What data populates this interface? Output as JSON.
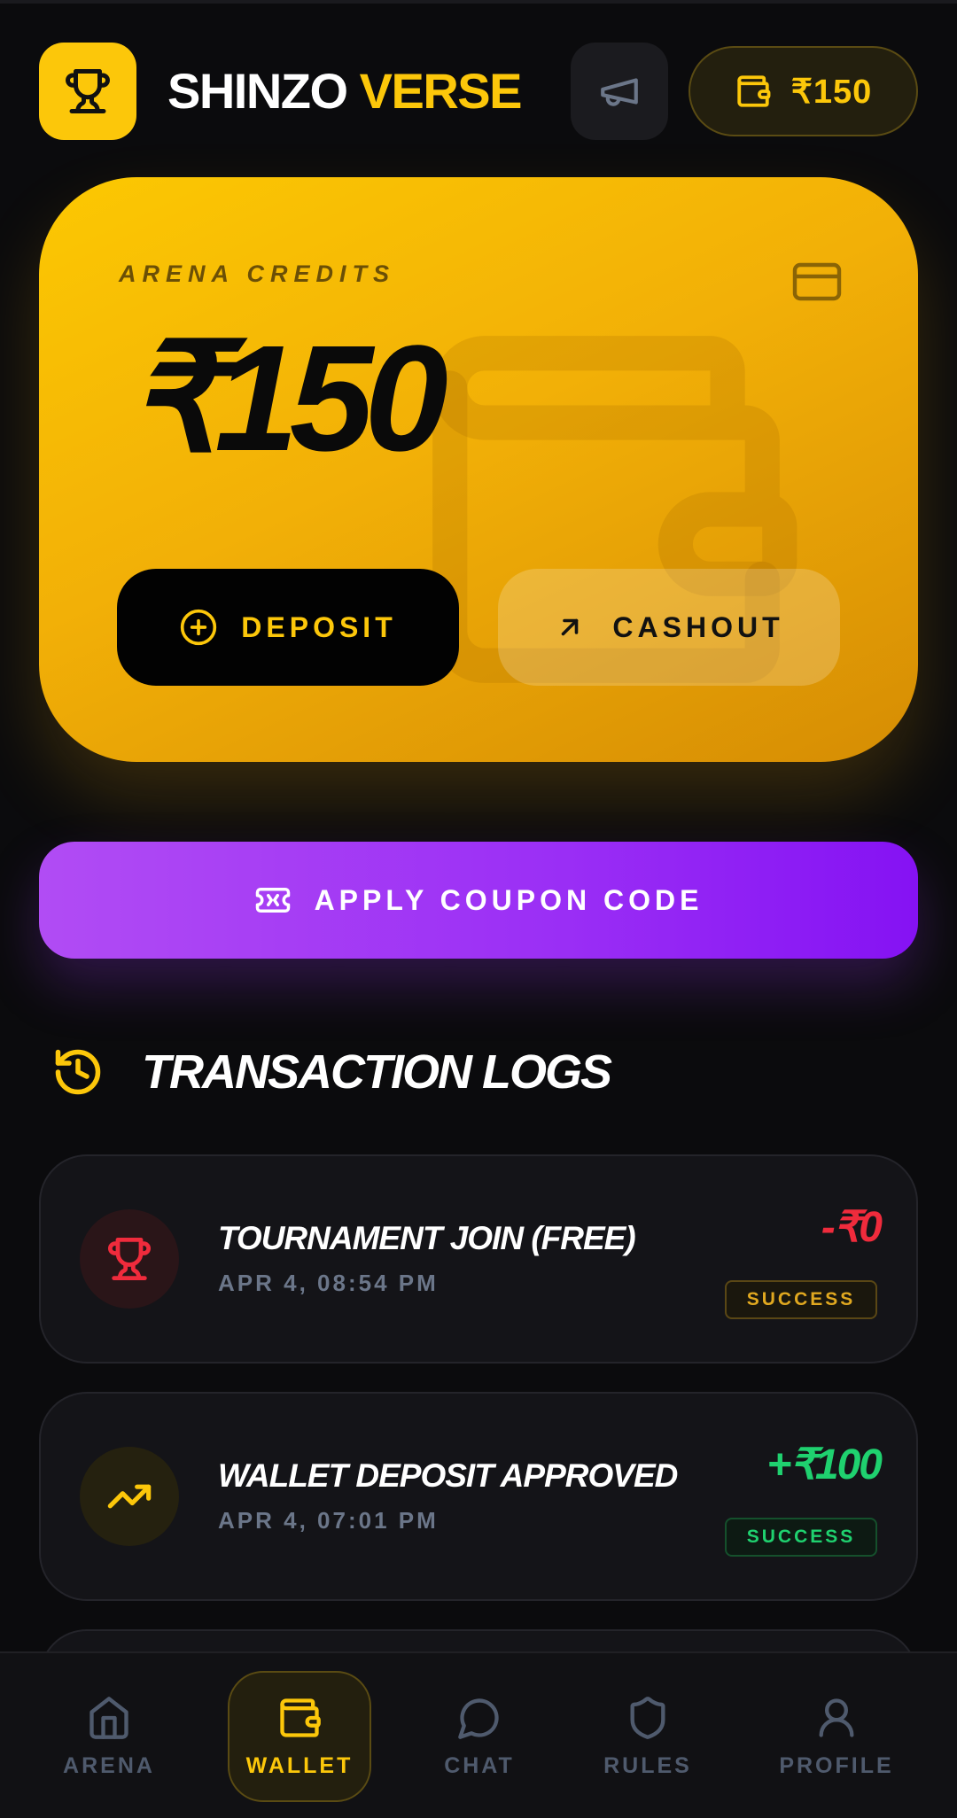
{
  "header": {
    "brand_first": "SHINZO",
    "brand_second": "VERSE",
    "wallet_balance": "₹150",
    "logo_icon": "trophy-icon",
    "announce_icon": "megaphone-icon",
    "wallet_icon": "wallet-icon"
  },
  "credits_card": {
    "label": "ARENA CREDITS",
    "balance": "₹150",
    "deposit_label": "DEPOSIT",
    "cashout_label": "CASHOUT"
  },
  "coupon": {
    "label": "APPLY COUPON CODE"
  },
  "transactions": {
    "title": "TRANSACTION LOGS",
    "items": [
      {
        "name": "TOURNAMENT JOIN (FREE)",
        "date": "APR 4, 08:54 PM",
        "amount": "-₹0",
        "status": "SUCCESS",
        "icon": "trophy-icon",
        "amount_color": "#ef2b3c",
        "status_color": "#e0a820"
      },
      {
        "name": "WALLET DEPOSIT APPROVED",
        "date": "APR 4, 07:01 PM",
        "amount": "+₹100",
        "status": "SUCCESS",
        "icon": "trending-up-icon",
        "amount_color": "#1fd16f",
        "status_color": "#1fd16f"
      }
    ]
  },
  "nav": {
    "items": [
      {
        "label": "ARENA",
        "icon": "home-icon"
      },
      {
        "label": "WALLET",
        "icon": "wallet-icon",
        "active": true
      },
      {
        "label": "CHAT",
        "icon": "chat-icon"
      },
      {
        "label": "RULES",
        "icon": "shield-icon"
      },
      {
        "label": "PROFILE",
        "icon": "user-icon"
      }
    ]
  },
  "colors": {
    "accent": "#fcc70a",
    "purple": "#9a2ef5",
    "background": "#0b0b0d"
  }
}
